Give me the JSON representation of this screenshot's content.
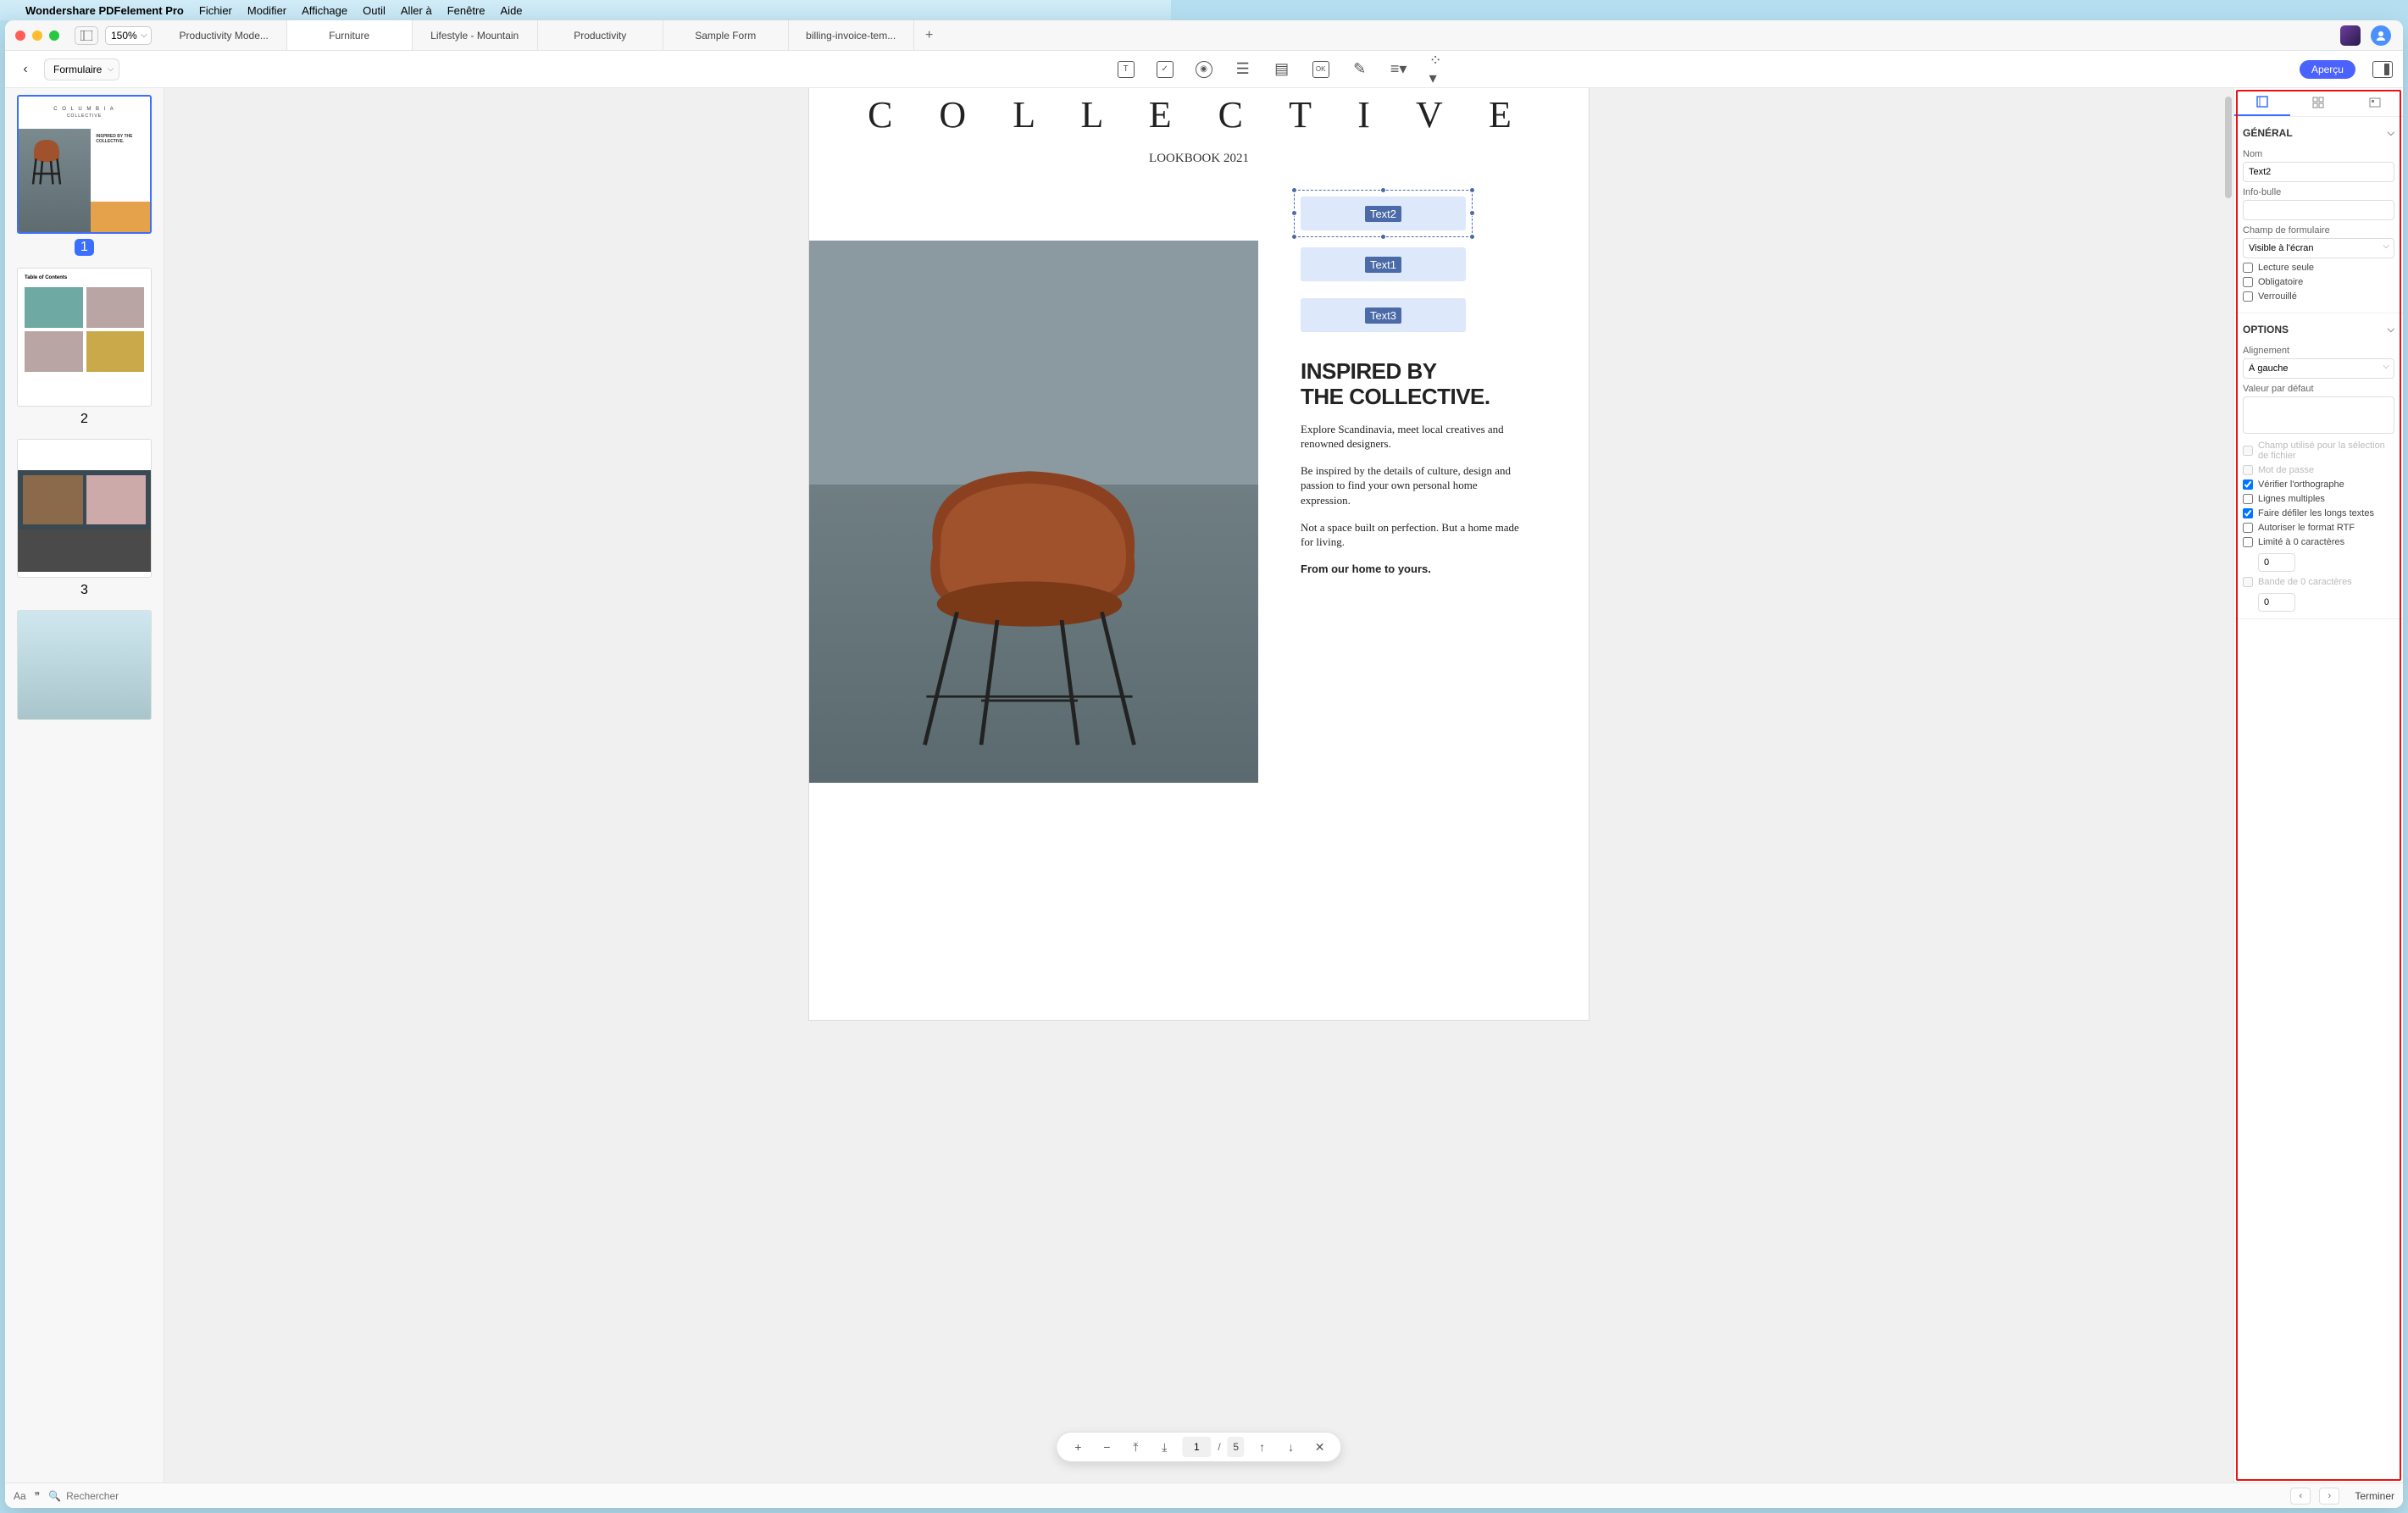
{
  "menubar": {
    "app": "Wondershare PDFelement Pro",
    "items": [
      "Fichier",
      "Modifier",
      "Affichage",
      "Outil",
      "Aller à",
      "Fenêtre",
      "Aide"
    ]
  },
  "window": {
    "zoom": "150%",
    "tabs": [
      "Productivity Mode...",
      "Furniture",
      "Lifestyle - Mountain",
      "Productivity",
      "Sample Form",
      "billing-invoice-tem..."
    ],
    "active_tab_index": 1
  },
  "toolbar": {
    "mode": "Formulaire",
    "apercu": "Aperçu"
  },
  "thumbs": {
    "pages": [
      "1",
      "2",
      "3"
    ],
    "t1_title1": "C O L U M B I A",
    "t1_title2": "COLLECTIVE",
    "t1_caption": "INSPIRED BY THE COLLECTIVE.",
    "t2_title": "Table of Contents"
  },
  "doc": {
    "title": "C  O  L  L  E  C  T  I  V  E",
    "subtitle": "LOOKBOOK 2021",
    "fields": {
      "f1": "Text2",
      "f2": "Text1",
      "f3": "Text3"
    },
    "heading": "INSPIRED BY THE COLLECTIVE.",
    "h_line1": "INSPIRED BY",
    "h_line2": "THE COLLECTIVE.",
    "p1": "Explore Scandinavia, meet local creatives and renowned designers.",
    "p2": "Be inspired by the details of culture, design and passion to find your own personal home expression.",
    "p3": "Not a space built on perfection. But a home made for living.",
    "p4": "From our home to yours."
  },
  "pagectrl": {
    "current": "1",
    "total": "5"
  },
  "props": {
    "section_general": "GÉNÉRAL",
    "lbl_nom": "Nom",
    "val_nom": "Text2",
    "lbl_info": "Info-bulle",
    "val_info": "",
    "lbl_champ": "Champ de formulaire",
    "val_champ": "Visible à l'écran",
    "chk_lecture": "Lecture seule",
    "chk_oblig": "Obligatoire",
    "chk_verr": "Verrouillé",
    "section_options": "OPTIONS",
    "lbl_align": "Alignement",
    "val_align": "À gauche",
    "lbl_default": "Valeur par défaut",
    "val_default": "",
    "chk_fichier": "Champ utilisé pour la sélection de fichier",
    "chk_mdp": "Mot de passe",
    "chk_ortho": "Vérifier l'orthographe",
    "chk_multi": "Lignes multiples",
    "chk_defil": "Faire défiler les longs textes",
    "chk_rtf": "Autoriser le format RTF",
    "chk_limit": "Limité à 0 caractères",
    "num_limit": "0",
    "chk_bande": "Bande de 0 caractères",
    "num_bande": "0"
  },
  "status": {
    "search_placeholder": "Rechercher",
    "terminer": "Terminer"
  }
}
